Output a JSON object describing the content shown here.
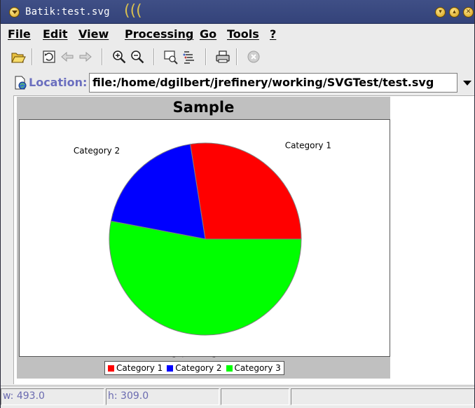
{
  "window": {
    "title": "Batik:test.svg",
    "title_decoration": "(((",
    "controls": [
      "minimize",
      "maximize",
      "close"
    ]
  },
  "menubar": {
    "items": [
      "File",
      "Edit",
      "View",
      "Processing",
      "Go",
      "Tools",
      "?"
    ]
  },
  "toolbar": {
    "icons": [
      "open-folder-icon",
      "reload-icon",
      "back-arrow-icon",
      "forward-arrow-icon",
      "zoom-in-icon",
      "zoom-out-icon",
      "thumbnail-icon",
      "dom-viewer-icon",
      "print-icon",
      "stop-icon"
    ]
  },
  "location": {
    "label": "Location:",
    "value": "file:/home/dgilbert/jrefinery/working/SVGTest/test.svg"
  },
  "chart_data": {
    "type": "pie",
    "title": "Sample",
    "slices": [
      {
        "name": "Category 1",
        "value": 27.5,
        "color": "#ff0000"
      },
      {
        "name": "Category 2",
        "value": 19.5,
        "color": "#0000ff"
      },
      {
        "name": "Category 3",
        "value": 53.0,
        "color": "#00ff00"
      }
    ],
    "legend_position": "bottom"
  },
  "status": {
    "width": "w: 493.0",
    "height": "h: 309.0",
    "cell3": "",
    "cell4": ""
  },
  "colors": {
    "titlebar": "#3f4f86",
    "location_label": "#6b6fbf",
    "status_text": "#6a6ab0"
  }
}
